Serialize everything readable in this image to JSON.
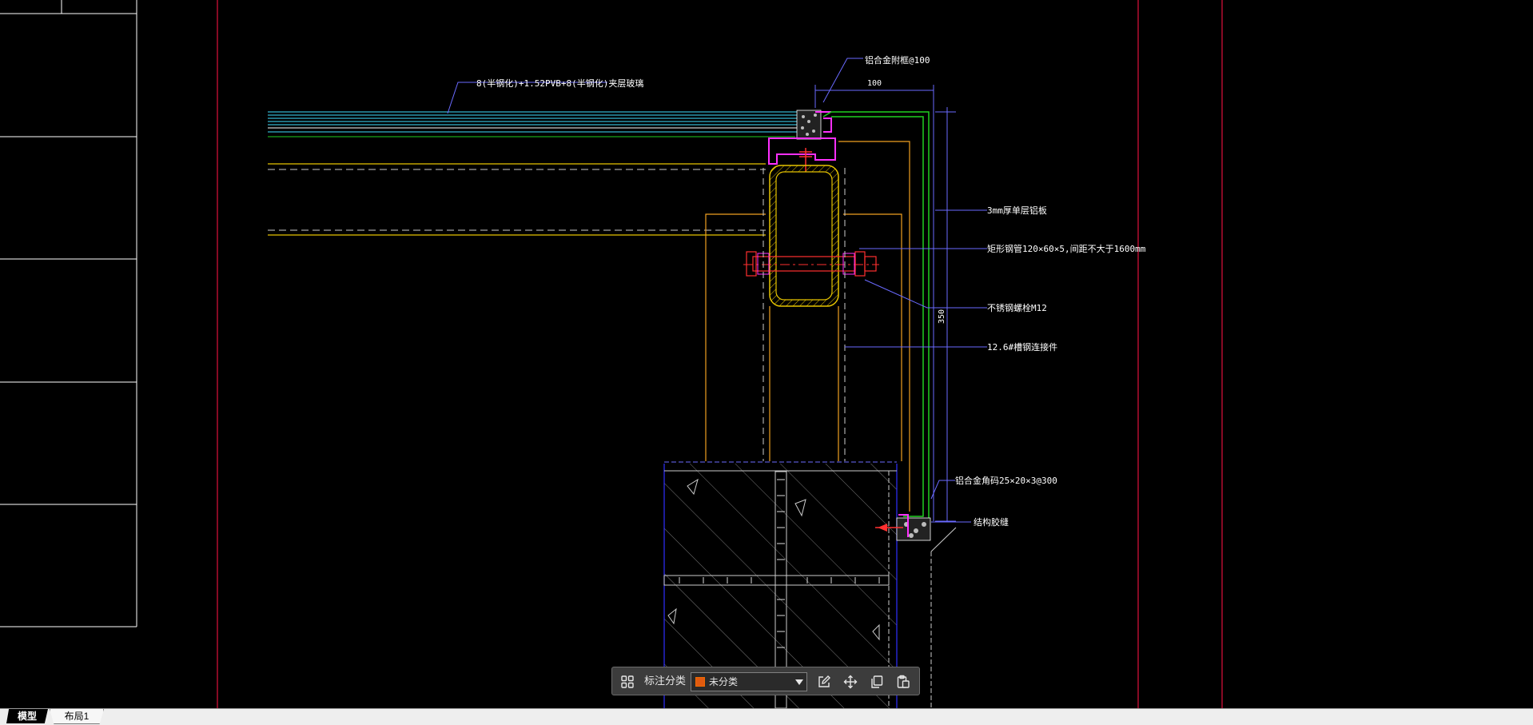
{
  "tabs": {
    "model": "模型",
    "layout1": "布局1"
  },
  "annotations": {
    "glass": "8(半钢化)+1.52PVB+8(半钢化)夹层玻璃",
    "aluminum_clip": "铝合金附框@100",
    "dim_top": "100",
    "panel": "3mm厚单层铝板",
    "steel_tube": "矩形钢管120×60×5,间距不大于1600mm",
    "bolt": "不锈钢螺栓M12",
    "plate": "12.6#槽钢连接件",
    "angle": "铝合金角码25×20×3@300",
    "sealant": "结构胶缝",
    "dim_side": "350"
  },
  "toolbar": {
    "label": "标注分类",
    "category": "未分类",
    "swatch_color": "#e05a10",
    "icons": [
      "layout-grid-icon",
      "edit-icon",
      "move-icon",
      "copy-icon",
      "paste-icon"
    ]
  },
  "colors": {
    "background": "#000000",
    "frame_red": "#e0103c",
    "glass_cyan": "#40e0ff",
    "green": "#20d020",
    "yellow": "#e6c400",
    "orange": "#f0a020",
    "magenta": "#ff30ff",
    "blue": "#3030ff",
    "white": "#ffffff",
    "gray": "#aaaaaa"
  }
}
